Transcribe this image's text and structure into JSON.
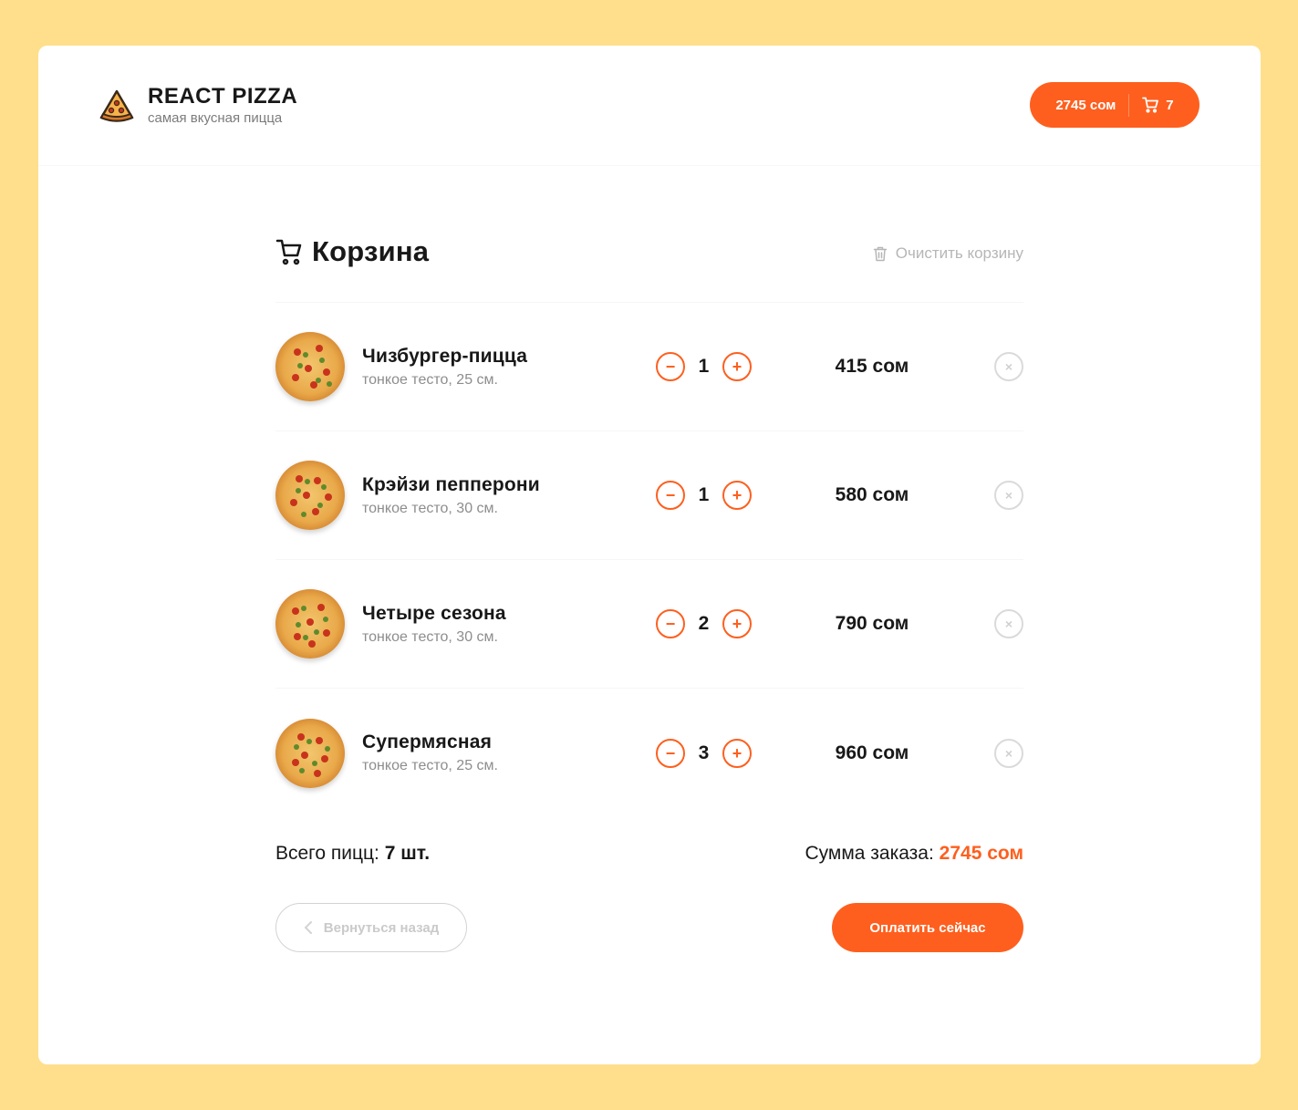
{
  "brand": {
    "title": "REACT PIZZA",
    "subtitle": "самая вкусная пицца"
  },
  "header_cart": {
    "total": "2745 сом",
    "count": "7"
  },
  "cart": {
    "title": "Корзина",
    "clear_label": "Очистить корзину",
    "items": [
      {
        "name": "Чизбургер-пицца",
        "desc": "тонкое тесто, 25 см.",
        "count": "1",
        "price": "415 сом"
      },
      {
        "name": "Крэйзи пепперони",
        "desc": "тонкое тесто, 30 см.",
        "count": "1",
        "price": "580 сом"
      },
      {
        "name": "Четыре сезона",
        "desc": "тонкое тесто, 30 см.",
        "count": "2",
        "price": "790 сом"
      },
      {
        "name": "Супермясная",
        "desc": "тонкое тесто, 25 см.",
        "count": "3",
        "price": "960 сом"
      }
    ],
    "minus_symbol": "−",
    "plus_symbol": "+",
    "remove_symbol": "×",
    "total_count_label": "Всего пицц:",
    "total_count_value": "7 шт.",
    "total_price_label": "Сумма заказа:",
    "total_price_value": "2745 сом",
    "back_label": "Вернуться назад",
    "pay_label": "Оплатить сейчас"
  },
  "colors": {
    "accent": "#fe5f1e",
    "background": "#ffdf8c"
  },
  "icons": [
    "pizza-logo-icon",
    "cart-icon",
    "trash-icon",
    "pizza-image",
    "minus-icon",
    "plus-icon",
    "remove-icon",
    "chevron-left-icon"
  ]
}
